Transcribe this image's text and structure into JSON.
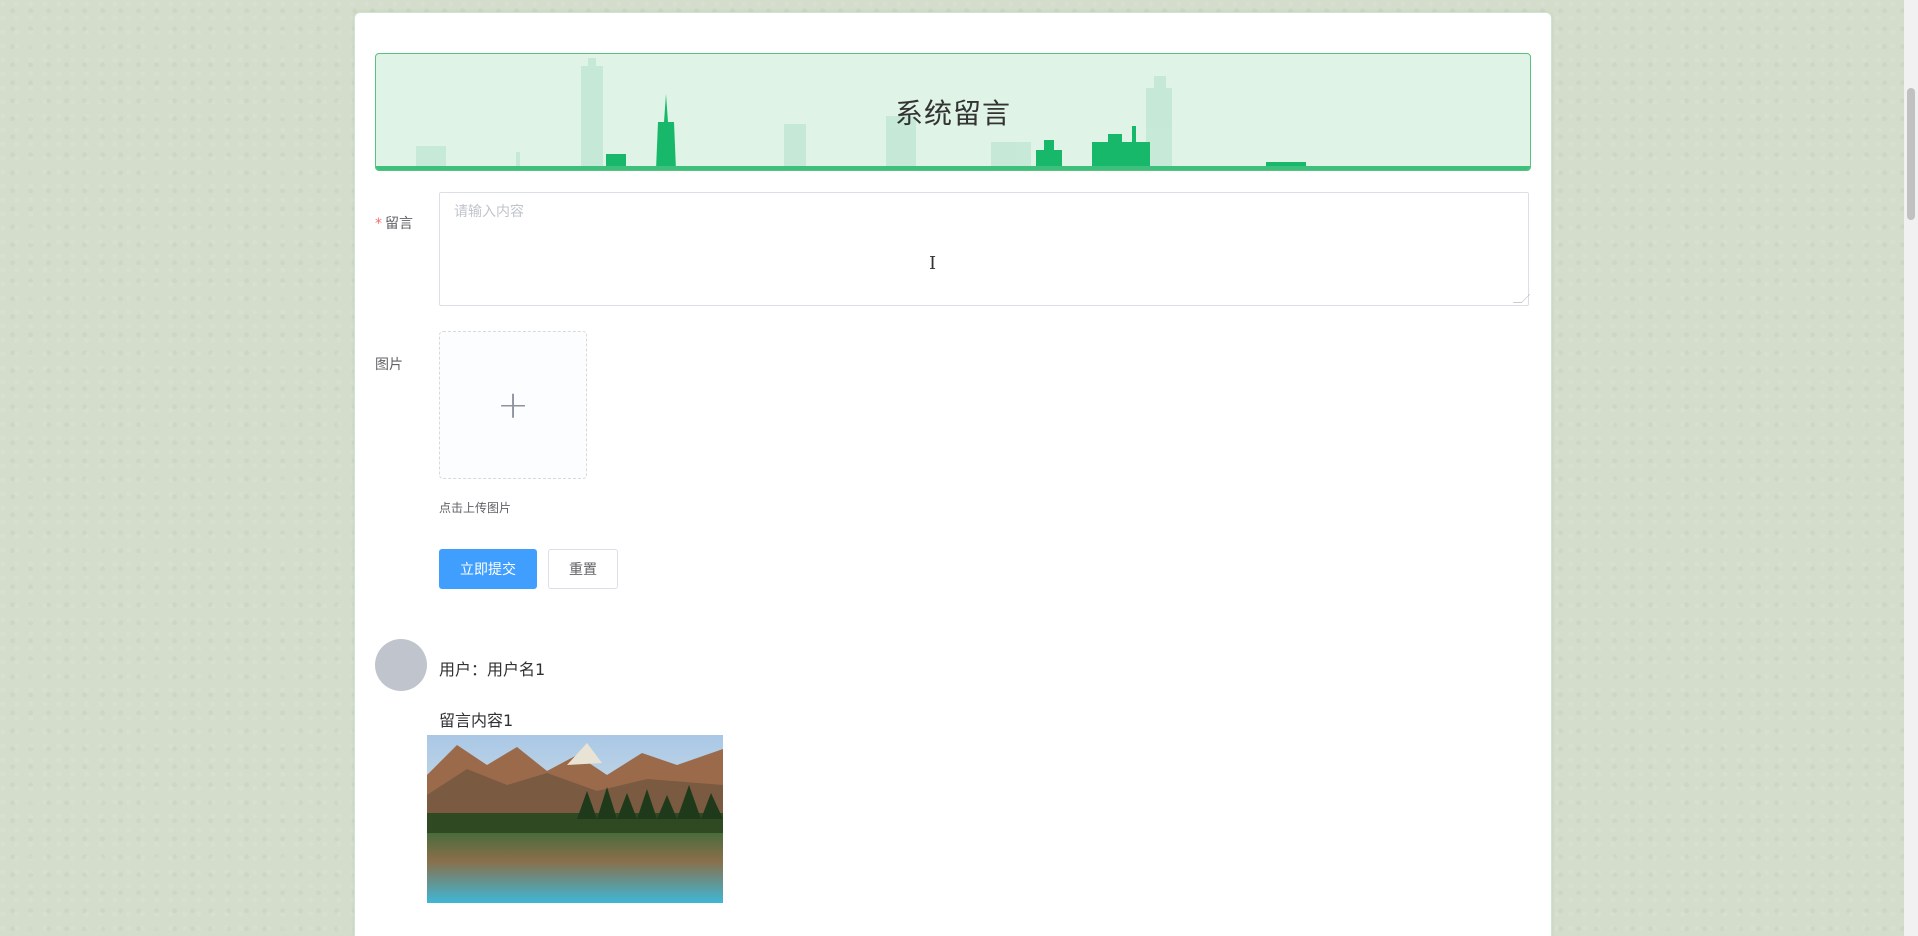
{
  "banner": {
    "title": "系统留言"
  },
  "form": {
    "message_label": "留言",
    "required_mark": "*",
    "message_placeholder": "请输入内容",
    "image_label": "图片",
    "upload_tip": "点击上传图片",
    "submit_label": "立即提交",
    "reset_label": "重置"
  },
  "messages": [
    {
      "user": "用户：用户名1",
      "content": "留言内容1"
    }
  ],
  "icons": {
    "upload": "plus-icon",
    "cursor": "text-cursor-icon"
  },
  "colors": {
    "primary": "#409eff",
    "banner_bg": "#dff3e6",
    "banner_accent": "#18b86a",
    "required": "#f56c6c"
  }
}
